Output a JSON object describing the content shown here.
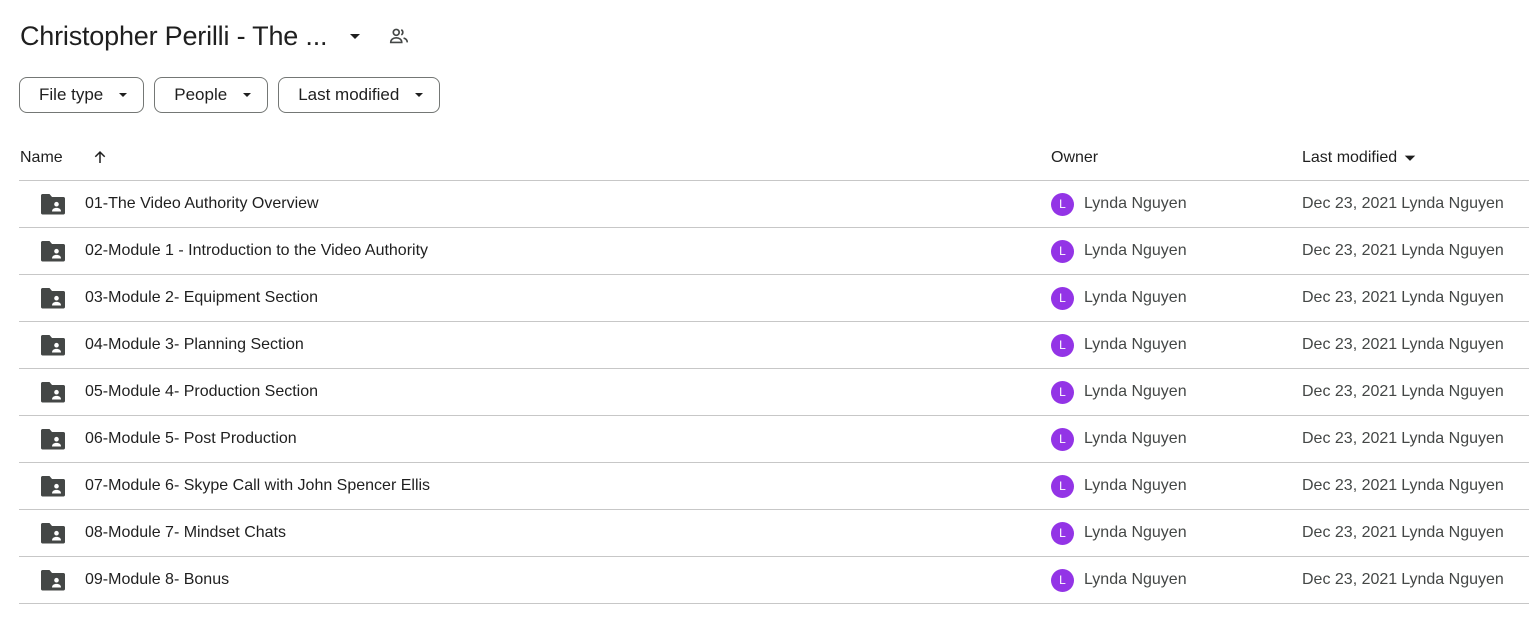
{
  "header": {
    "title": "Christopher Perilli - The ...",
    "title_menu_icon": "arrow-drop-down-icon",
    "shared_icon": "people-icon"
  },
  "filters": [
    {
      "label": "File type",
      "icon": "arrow-drop-down-icon"
    },
    {
      "label": "People",
      "icon": "arrow-drop-down-icon"
    },
    {
      "label": "Last modified",
      "icon": "arrow-drop-down-icon"
    }
  ],
  "table": {
    "columns": {
      "name": "Name",
      "owner": "Owner",
      "last_modified": "Last modified"
    },
    "sort_icon": "arrow-upward-icon",
    "rows": [
      {
        "name": "01-The Video Authority Overview",
        "owner_initial": "L",
        "owner": "Lynda Nguyen",
        "date": "Dec 23, 2021",
        "modified_by": "Lynda Nguyen"
      },
      {
        "name": "02-Module 1 - Introduction to the Video Authority",
        "owner_initial": "L",
        "owner": "Lynda Nguyen",
        "date": "Dec 23, 2021",
        "modified_by": "Lynda Nguyen"
      },
      {
        "name": "03-Module 2- Equipment Section",
        "owner_initial": "L",
        "owner": "Lynda Nguyen",
        "date": "Dec 23, 2021",
        "modified_by": "Lynda Nguyen"
      },
      {
        "name": "04-Module 3- Planning Section",
        "owner_initial": "L",
        "owner": "Lynda Nguyen",
        "date": "Dec 23, 2021",
        "modified_by": "Lynda Nguyen"
      },
      {
        "name": "05-Module 4- Production Section",
        "owner_initial": "L",
        "owner": "Lynda Nguyen",
        "date": "Dec 23, 2021",
        "modified_by": "Lynda Nguyen"
      },
      {
        "name": "06-Module 5- Post Production",
        "owner_initial": "L",
        "owner": "Lynda Nguyen",
        "date": "Dec 23, 2021",
        "modified_by": "Lynda Nguyen"
      },
      {
        "name": "07-Module 6- Skype Call with John Spencer Ellis",
        "owner_initial": "L",
        "owner": "Lynda Nguyen",
        "date": "Dec 23, 2021",
        "modified_by": "Lynda Nguyen"
      },
      {
        "name": "08-Module 7- Mindset Chats",
        "owner_initial": "L",
        "owner": "Lynda Nguyen",
        "date": "Dec 23, 2021",
        "modified_by": "Lynda Nguyen"
      },
      {
        "name": "09-Module 8- Bonus",
        "owner_initial": "L",
        "owner": "Lynda Nguyen",
        "date": "Dec 23, 2021",
        "modified_by": "Lynda Nguyen"
      }
    ],
    "row_icon": "shared-folder-icon"
  },
  "colors": {
    "avatar": "#9334e6",
    "icon": "#444746",
    "divider": "#c7c7c7"
  }
}
